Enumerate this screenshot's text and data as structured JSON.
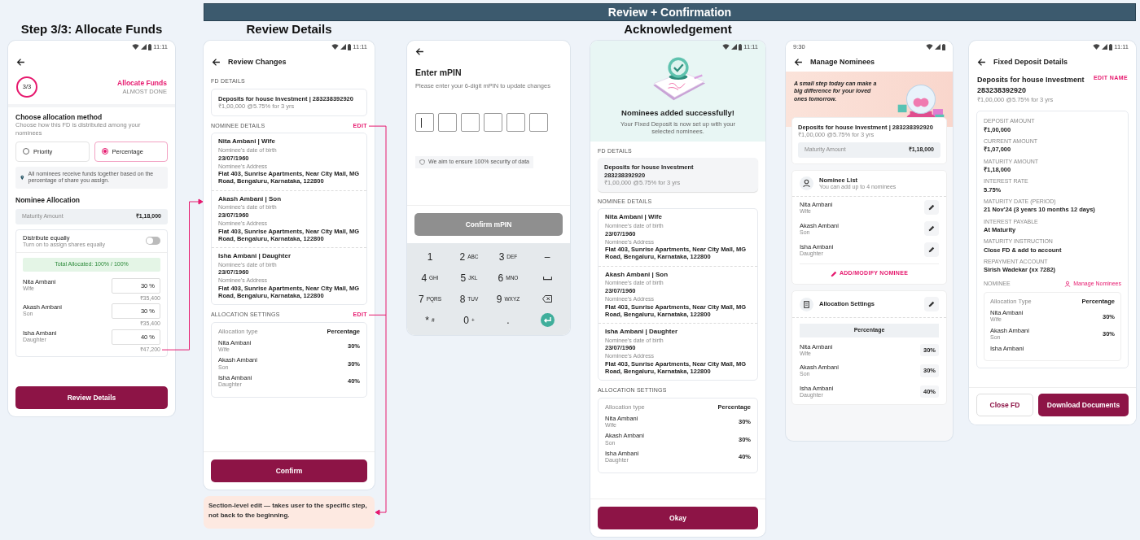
{
  "banner": {
    "title": "Review + Confirmation"
  },
  "note": "Section-level edit — takes user to the specific step, not back to the beginning.",
  "screens": [
    {
      "kind": "allocate",
      "heading": "Step 3/3: Allocate Funds",
      "status_time": "11:11",
      "step": "3/3",
      "step_title": "Allocate Funds",
      "step_subtitle": "ALMOST DONE",
      "method_title": "Choose allocation method",
      "method_subtitle": "Choose how this FD is distributed among your nominees",
      "methods": [
        {
          "label": "Priority",
          "selected": false
        },
        {
          "label": "Percentage",
          "selected": true
        }
      ],
      "info": "All nominees receive funds together based on the percentage of share you assign.",
      "allocation_title": "Nominee Allocation",
      "maturity_label": "Maturity Amount",
      "maturity_value": "₹1,18,000",
      "distribute_title": "Distribute equally",
      "distribute_subtitle": "Turn on to assign shares equally",
      "distribute_on": false,
      "total": "Total Allocated: 100% / 100%",
      "nominees": [
        {
          "name": "Nita Ambani",
          "relation": "Wife",
          "value": "30 %",
          "amount": "₹35,400"
        },
        {
          "name": "Akash Ambani",
          "relation": "Son",
          "value": "30 %",
          "amount": "₹35,400"
        },
        {
          "name": "Isha Ambani",
          "relation": "Daughter",
          "value": "40 %",
          "amount": "₹47,200"
        }
      ],
      "button": "Review Details"
    },
    {
      "kind": "review",
      "heading": "Review Details",
      "status_time": "11:11",
      "title": "Review Changes",
      "fd_label": "FD DETAILS",
      "fd": {
        "name": "Deposits for house Investment | 283238392920",
        "terms": "₹1,00,000 @5.75% for 3 yrs"
      },
      "nominee_label": "NOMINEE DETAILS",
      "nominee_edit": "EDIT",
      "nominees": [
        {
          "title": "Nita Ambani | Wife",
          "dob_label": "Nominee's date of birth",
          "dob": "23/07/1960",
          "address_label": "Nominee's Address",
          "address": "Flat 403, Sunrise Apartments, Near City Mall, MG Road, Bengaluru, Karnataka, 122800"
        },
        {
          "title": "Akash Ambani | Son",
          "dob_label": "Nominee's date of birth",
          "dob": "23/07/1960",
          "address_label": "Nominee's Address",
          "address": "Flat 403, Sunrise Apartments, Near City Mall, MG Road, Bengaluru, Karnataka, 122800"
        },
        {
          "title": "Isha Ambani | Daughter",
          "dob_label": "Nominee's date of birth",
          "dob": "23/07/1960",
          "address_label": "Nominee's Address",
          "address": "Flat 403, Sunrise Apartments, Near City Mall, MG Road, Bengaluru, Karnataka, 122800"
        }
      ],
      "allocation_label": "ALLOCATION SETTINGS",
      "allocation_edit": "EDIT",
      "allocation": {
        "type_label": "Allocation type",
        "type_value": "Percentage",
        "rows": [
          {
            "name": "Nita Ambani",
            "relation": "Wife",
            "share": "30%"
          },
          {
            "name": "Akash Ambani",
            "relation": "Son",
            "share": "30%"
          },
          {
            "name": "Isha Ambani",
            "relation": "Daughter",
            "share": "40%"
          }
        ]
      },
      "button": "Confirm"
    },
    {
      "kind": "mpin",
      "title": "Enter mPIN",
      "subtitle": "Please enter your 6-digit mPIN to update changes",
      "security": "We aim to ensure 100% security of data",
      "button": "Confirm mPIN",
      "button_disabled": true,
      "keys": [
        {
          "kind": "key",
          "main": "1"
        },
        {
          "kind": "key",
          "main": "2",
          "sub": "ABC"
        },
        {
          "kind": "key",
          "main": "3",
          "sub": "DEF"
        },
        {
          "kind": "key",
          "main": "–"
        },
        {
          "kind": "key",
          "main": "4",
          "sub": "GHI"
        },
        {
          "kind": "key",
          "main": "5",
          "sub": "JKL"
        },
        {
          "kind": "key",
          "main": "6",
          "sub": "MNO"
        },
        {
          "kind": "space"
        },
        {
          "kind": "key",
          "main": "7",
          "sub": "PQRS"
        },
        {
          "kind": "key",
          "main": "8",
          "sub": "TUV"
        },
        {
          "kind": "key",
          "main": "9",
          "sub": "WXYZ"
        },
        {
          "kind": "backspace"
        },
        {
          "kind": "key",
          "main": "*",
          "sub": "#"
        },
        {
          "kind": "key",
          "main": "0",
          "sub": "+"
        },
        {
          "kind": "key",
          "main": "."
        },
        {
          "kind": "enter"
        }
      ]
    },
    {
      "kind": "acknowledgement",
      "heading": "Acknowledgement",
      "status_time": "11:11",
      "success_title": "Nominees added successfully!",
      "success_text": "Your Fixed Deposit is now set up with your selected nominees.",
      "fd_label": "FD DETAILS",
      "fd": {
        "name": "Deposits for house Investment",
        "number": "283238392920",
        "terms": "₹1,00,000 @5.75% for 3 yrs"
      },
      "nominee_label": "NOMINEE DETAILS",
      "nominees": [
        {
          "title": "Nita Ambani | Wife",
          "dob_label": "Nominee's date of birth",
          "dob": "23/07/1960",
          "address_label": "Nominee's Address",
          "address": "Flat 403, Sunrise Apartments, Near City Mall, MG Road, Bengaluru, Karnataka, 122800"
        },
        {
          "title": "Akash Ambani | Son",
          "dob_label": "Nominee's date of birth",
          "dob": "23/07/1960",
          "address_label": "Nominee's Address",
          "address": "Flat 403, Sunrise Apartments, Near City Mall, MG Road, Bengaluru, Karnataka, 122800"
        },
        {
          "title": "Isha Ambani | Daughter",
          "dob_label": "Nominee's date of birth",
          "dob": "23/07/1960",
          "address_label": "Nominee's Address",
          "address": "Flat 403, Sunrise Apartments, Near City Mall, MG Road, Bengaluru, Karnataka, 122800"
        }
      ],
      "allocation_label": "ALLOCATION SETTINGS",
      "allocation": {
        "type_label": "Allocation type",
        "type_value": "Percentage",
        "rows": [
          {
            "name": "Nita Ambani",
            "relation": "Wife",
            "share": "30%"
          },
          {
            "name": "Akash Ambani",
            "relation": "Son",
            "share": "30%"
          },
          {
            "name": "Isha Ambani",
            "relation": "Daughter",
            "share": "40%"
          }
        ]
      },
      "button": "Okay"
    },
    {
      "kind": "manage",
      "status_time": "9:30",
      "title": "Manage Nominees",
      "promo": "A small step today can make a big difference for your loved ones tomorrow.",
      "fd": {
        "name": "Deposits for house Investment | 283238392920",
        "terms": "₹1,00,000 @5.75% for 3 yrs"
      },
      "maturity_label": "Maturity Amount",
      "maturity_value": "₹1,18,000",
      "list_title": "Nominee List",
      "list_subtitle": "You can add up to 4 nominees",
      "nominees": [
        {
          "name": "Nita Ambani",
          "relation": "Wife"
        },
        {
          "name": "Akash Ambani",
          "relation": "Son"
        },
        {
          "name": "Isha Ambani",
          "relation": "Daughter"
        }
      ],
      "add_link": "ADD/MODIFY NOMINEE",
      "settings_title": "Allocation Settings",
      "settings_header": "Percentage",
      "rows": [
        {
          "name": "Nita Ambani",
          "relation": "Wife",
          "share": "30%"
        },
        {
          "name": "Akash Ambani",
          "relation": "Son",
          "share": "30%"
        },
        {
          "name": "Isha Ambani",
          "relation": "Daughter",
          "share": "40%"
        }
      ]
    },
    {
      "kind": "fd_details",
      "status_time": "11:11",
      "title": "Fixed Deposit Details",
      "fd": {
        "name": "Deposits for house Investment",
        "number": "283238392920",
        "terms": "₹1,00,000 @5.75% for 3 yrs"
      },
      "edit_name": "EDIT NAME",
      "details": [
        {
          "label": "DEPOSIT AMOUNT",
          "value": "₹1,00,000"
        },
        {
          "label": "CURRENT AMOUNT",
          "value": "₹1,07,000"
        },
        {
          "label": "MATURITY AMOUNT",
          "value": "₹1,18,000"
        },
        {
          "label": "INTEREST RATE",
          "value": "5.75%"
        },
        {
          "label": "MATURITY DATE (PERIOD)",
          "value": "21 Nov'24 (3 years 10 months 12 days)"
        },
        {
          "label": "INTEREST PAYABLE",
          "value": "At Maturity"
        },
        {
          "label": "MATURITY INSTRUCTION",
          "value": "Close FD & add to account"
        },
        {
          "label": "REPAYMENT ACCOUNT",
          "value": "Sirish Wadekar (xx 7282)"
        }
      ],
      "nominee_label": "NOMINEE",
      "manage_link": "Manage Nominees",
      "allocation": {
        "type_label": "Allocation Type",
        "type_value": "Percentage",
        "rows": [
          {
            "name": "Nita Ambani",
            "relation": "Wife",
            "share": "30%"
          },
          {
            "name": "Akash Ambani",
            "relation": "Son",
            "share": "30%"
          },
          {
            "name": "Isha Ambani"
          }
        ]
      },
      "buttons": [
        "Close FD",
        "Download Documents"
      ]
    }
  ]
}
